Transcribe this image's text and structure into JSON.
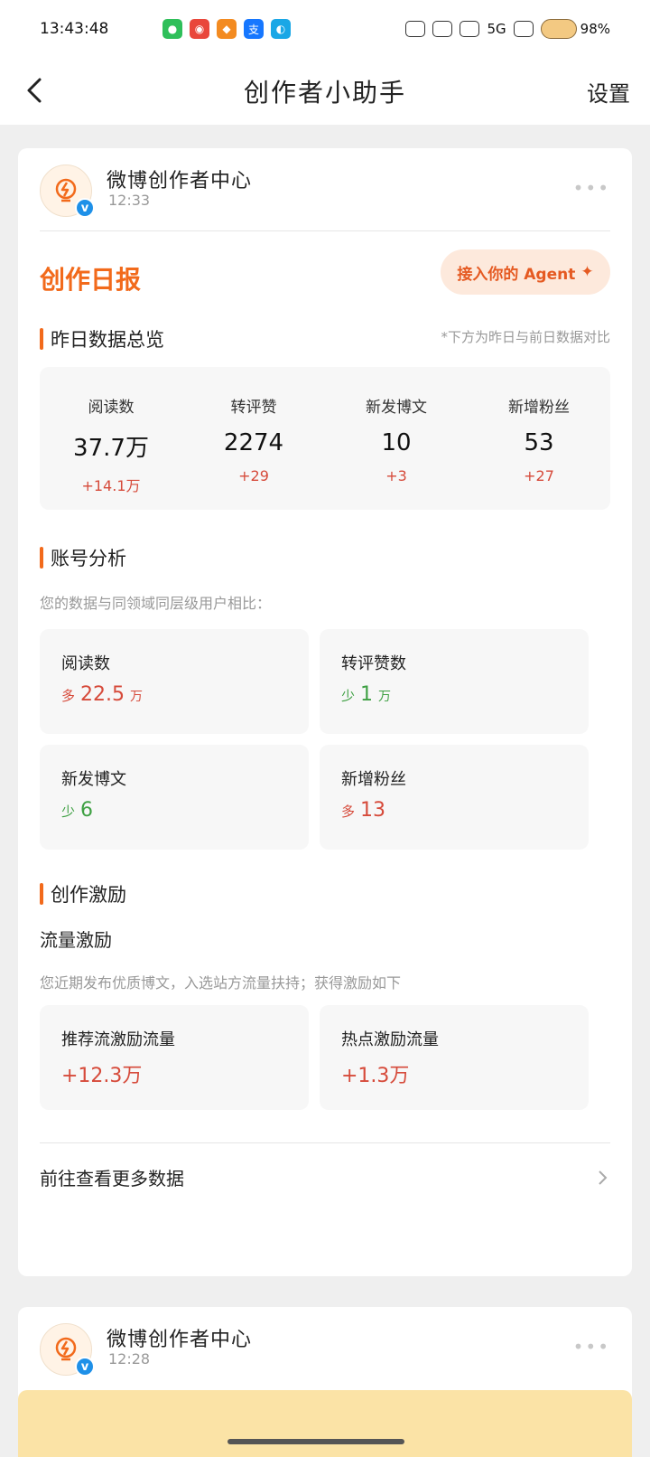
{
  "status_bar": {
    "time": "13:43:48",
    "network": "5G",
    "battery": "98%"
  },
  "nav": {
    "title": "创作者小助手",
    "settings_label": "设置"
  },
  "message1": {
    "sender": "微博创作者中心",
    "time": "12:33",
    "report_title": "创作日报",
    "agent_button": "接入你的 Agent",
    "overview": {
      "heading": "昨日数据总览",
      "note": "*下方为昨日与前日数据对比",
      "stats": [
        {
          "label": "阅读数",
          "value": "37.7万",
          "delta": "+14.1万"
        },
        {
          "label": "转评赞",
          "value": "2274",
          "delta": "+29"
        },
        {
          "label": "新发博文",
          "value": "10",
          "delta": "+3"
        },
        {
          "label": "新增粉丝",
          "value": "53",
          "delta": "+27"
        }
      ]
    },
    "analysis": {
      "heading": "账号分析",
      "desc": "您的数据与同领域同层级用户相比：",
      "items": [
        {
          "label": "阅读数",
          "prefix": "多",
          "value": "22.5",
          "unit": "万",
          "trend": "up"
        },
        {
          "label": "转评赞数",
          "prefix": "少",
          "value": "1",
          "unit": "万",
          "trend": "down"
        },
        {
          "label": "新发博文",
          "prefix": "少",
          "value": "6",
          "unit": "",
          "trend": "down"
        },
        {
          "label": "新增粉丝",
          "prefix": "多",
          "value": "13",
          "unit": "",
          "trend": "up"
        }
      ]
    },
    "incentive": {
      "heading": "创作激励",
      "subheading": "流量激励",
      "desc": "您近期发布优质博文，入选站方流量扶持；获得激励如下",
      "items": [
        {
          "label": "推荐流激励流量",
          "value": "+12.3万"
        },
        {
          "label": "热点激励流量",
          "value": "+1.3万"
        }
      ]
    },
    "more_link": "前往查看更多数据"
  },
  "message2": {
    "sender": "微博创作者中心",
    "time": "12:28"
  }
}
